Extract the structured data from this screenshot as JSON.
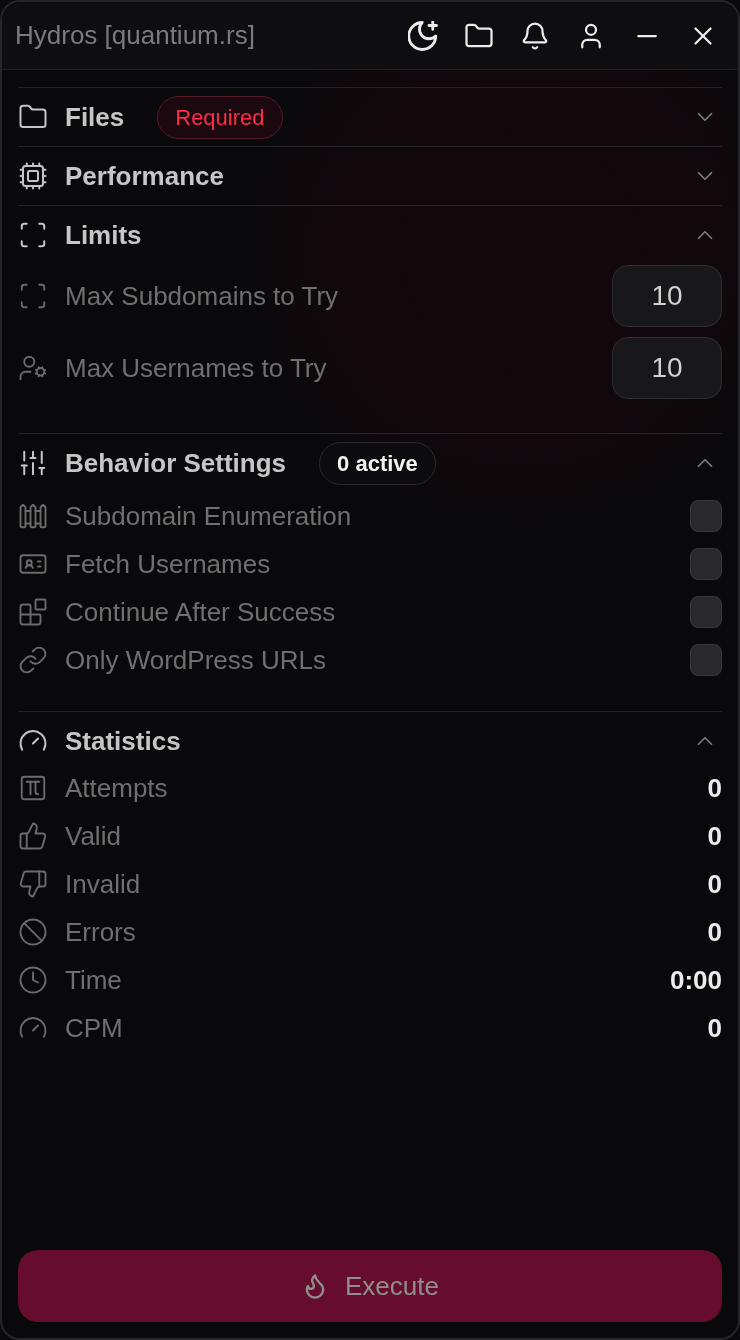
{
  "window": {
    "title": "Hydros [quantium.rs]"
  },
  "sections": [
    {
      "title": "Files",
      "expanded": false,
      "badge": {
        "text": "Required",
        "kind": "required"
      }
    },
    {
      "title": "Performance",
      "expanded": false
    },
    {
      "title": "Limits",
      "expanded": true,
      "kind": "inputs",
      "items": [
        {
          "label": "Max Subdomains to Try",
          "value": "10"
        },
        {
          "label": "Max Usernames to Try",
          "value": "10"
        }
      ]
    },
    {
      "title": "Behavior Settings",
      "expanded": true,
      "badge": {
        "text": "0 active",
        "kind": "count"
      },
      "kind": "checkboxes",
      "items": [
        {
          "label": "Subdomain Enumeration",
          "checked": false
        },
        {
          "label": "Fetch Usernames",
          "checked": false
        },
        {
          "label": "Continue After Success",
          "checked": false
        },
        {
          "label": "Only WordPress URLs",
          "checked": false
        }
      ]
    },
    {
      "title": "Statistics",
      "expanded": true,
      "kind": "stats",
      "items": [
        {
          "label": "Attempts",
          "value": "0"
        },
        {
          "label": "Valid",
          "value": "0"
        },
        {
          "label": "Invalid",
          "value": "0"
        },
        {
          "label": "Errors",
          "value": "0"
        },
        {
          "label": "Time",
          "value": "0:00"
        },
        {
          "label": "CPM",
          "value": "0"
        }
      ]
    }
  ],
  "execute_button": {
    "label": "Execute",
    "disabled": true
  }
}
